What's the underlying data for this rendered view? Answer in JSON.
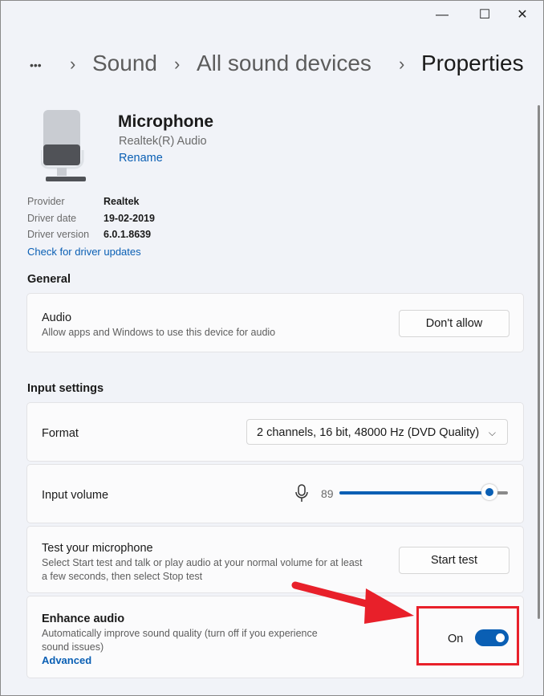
{
  "window": {
    "minimize": "—",
    "maximize": "☐",
    "close": "✕"
  },
  "breadcrumb": {
    "more": "•••",
    "sep": "›",
    "items": [
      "Sound",
      "All sound devices",
      "Properties"
    ]
  },
  "device": {
    "name": "Microphone",
    "subtitle": "Realtek(R) Audio",
    "rename": "Rename",
    "info": [
      {
        "label": "Provider",
        "value": "Realtek"
      },
      {
        "label": "Driver date",
        "value": "19-02-2019"
      },
      {
        "label": "Driver version",
        "value": "6.0.1.8639"
      }
    ],
    "check_updates": "Check for driver updates"
  },
  "general": {
    "heading": "General",
    "audio_title": "Audio",
    "audio_desc": "Allow apps and Windows to use this device for audio",
    "audio_button": "Don't allow"
  },
  "input": {
    "heading": "Input settings",
    "format_label": "Format",
    "format_value": "2 channels, 16 bit, 48000 Hz (DVD Quality)",
    "volume_label": "Input volume",
    "volume_value": "89",
    "volume_percent": 89,
    "test_title": "Test your microphone",
    "test_desc": "Select Start test and talk or play audio at your normal volume for at least a few seconds, then select Stop test",
    "test_button": "Start test",
    "enhance_title": "Enhance audio",
    "enhance_desc": "Automatically improve sound quality (turn off if you experience sound issues)",
    "enhance_link": "Advanced",
    "enhance_state": "On"
  },
  "colors": {
    "accent": "#0a5fb4",
    "annotation": "#e8202a"
  }
}
